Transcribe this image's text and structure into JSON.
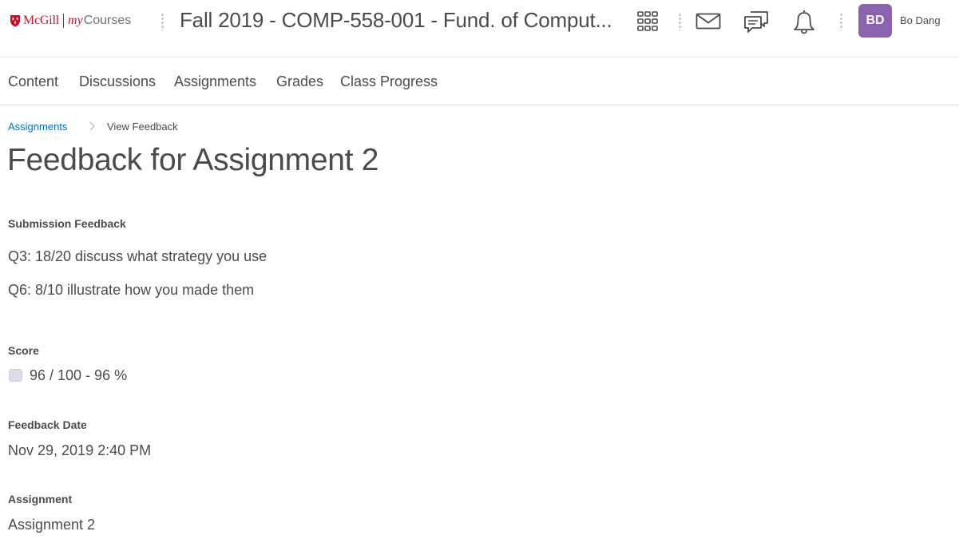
{
  "header": {
    "logo": {
      "brand": "McGill",
      "product_my": "my",
      "product_courses": "Courses"
    },
    "course_title": "Fall 2019 - COMP-558-001 - Fund. of Comput...",
    "icons": [
      "app-launcher-icon",
      "mail-icon",
      "chat-icon",
      "bell-icon"
    ],
    "user": {
      "initials": "BD",
      "name": "Bo Dang"
    }
  },
  "nav": {
    "items": [
      {
        "label": "Content"
      },
      {
        "label": "Discussions"
      },
      {
        "label": "Assignments"
      },
      {
        "label": "Grades"
      },
      {
        "label": "Class Progress"
      }
    ]
  },
  "breadcrumb": {
    "link": "Assignments",
    "current": "View Feedback"
  },
  "page": {
    "title": "Feedback for Assignment 2",
    "submission_feedback": {
      "label": "Submission Feedback",
      "lines": [
        "Q3: 18/20 discuss what strategy you use",
        "Q6: 8/10 illustrate how you made them"
      ]
    },
    "score": {
      "label": "Score",
      "value": "96 / 100 - 96 %"
    },
    "feedback_date": {
      "label": "Feedback Date",
      "value": "Nov 29, 2019 2:40 PM"
    },
    "assignment": {
      "label": "Assignment",
      "value": "Assignment 2"
    }
  },
  "colors": {
    "brand_red": "#c8102e",
    "avatar_purple": "#8a62ad",
    "link_blue": "#006fbf",
    "text": "#494c4e"
  }
}
